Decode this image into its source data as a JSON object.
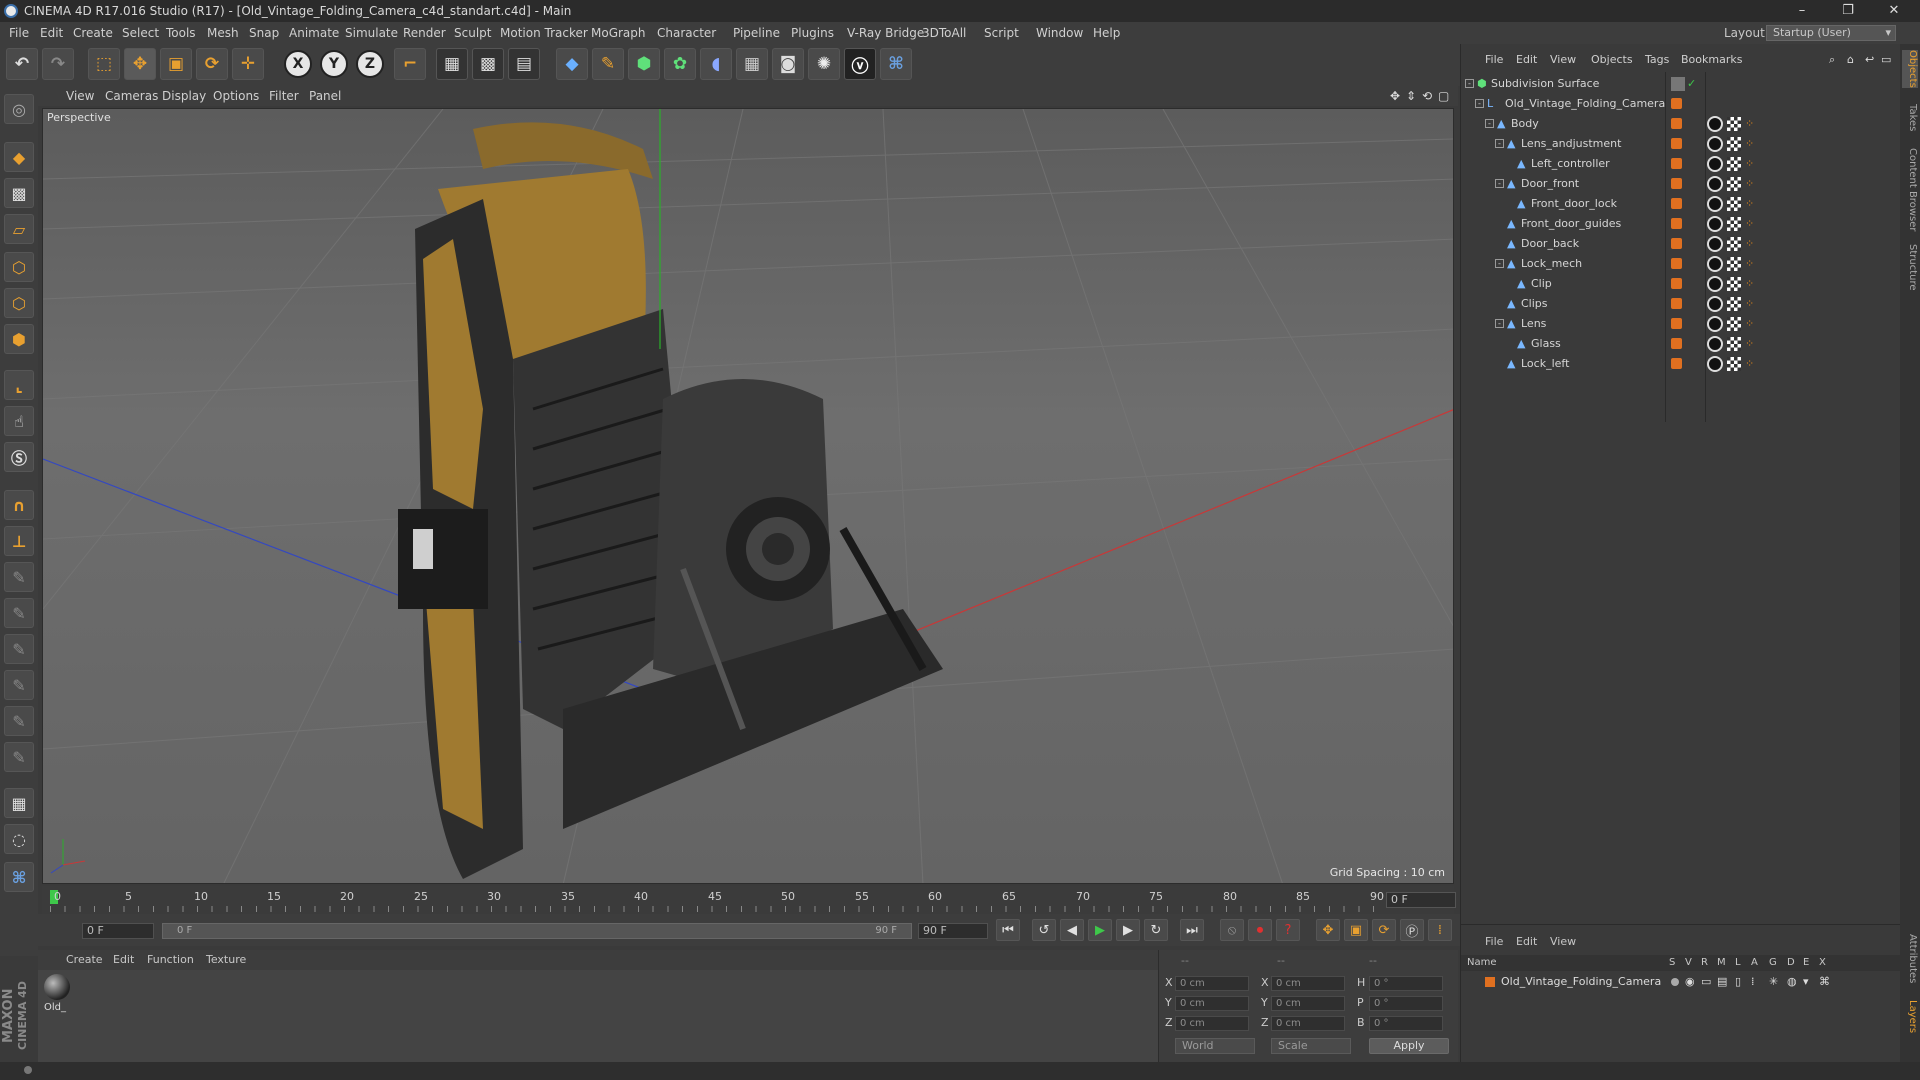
{
  "window": {
    "title": "CINEMA 4D R17.016 Studio (R17) - [Old_Vintage_Folding_Camera_c4d_standart.c4d] - Main",
    "minimize": "–",
    "maximize": "❐",
    "close": "✕"
  },
  "menubar": {
    "items": [
      "File",
      "Edit",
      "Create",
      "Select",
      "Tools",
      "Mesh",
      "Snap",
      "Animate",
      "Simulate",
      "Render",
      "Sculpt",
      "Motion Tracker",
      "MoGraph",
      "Character",
      "Pipeline",
      "Plugins",
      "V-Ray Bridge",
      "3DToAll",
      "Script",
      "Window",
      "Help"
    ],
    "layout_label": "Layout:",
    "layout_value": "Startup (User)"
  },
  "toolbar": {
    "axes": [
      "X",
      "Y",
      "Z"
    ]
  },
  "viewport": {
    "menu": [
      "View",
      "Cameras",
      "Display",
      "Options",
      "Filter",
      "Panel"
    ],
    "label": "Perspective",
    "grid_spacing": "Grid Spacing : 10 cm"
  },
  "timeline": {
    "ticks": [
      "0",
      "5",
      "10",
      "15",
      "20",
      "25",
      "30",
      "35",
      "40",
      "45",
      "50",
      "55",
      "60",
      "65",
      "70",
      "75",
      "80",
      "85",
      "90"
    ],
    "current_frame": "0 F",
    "start_field": "0 F",
    "range_start": "0 F",
    "range_end": "90 F",
    "end_field": "90 F"
  },
  "material_manager": {
    "menu": [
      "Create",
      "Edit",
      "Function",
      "Texture"
    ],
    "materials": [
      {
        "name": "Old_"
      }
    ],
    "brand_line1": "MAXON",
    "brand_line2": "CINEMA 4D"
  },
  "coordinates": {
    "header": [
      "--",
      "--",
      "--"
    ],
    "rows": [
      {
        "l1": "X",
        "v1": "0 cm",
        "l2": "X",
        "v2": "0 cm",
        "l3": "H",
        "v3": "0 °"
      },
      {
        "l1": "Y",
        "v1": "0 cm",
        "l2": "Y",
        "v2": "0 cm",
        "l3": "P",
        "v3": "0 °"
      },
      {
        "l1": "Z",
        "v1": "0 cm",
        "l2": "Z",
        "v2": "0 cm",
        "l3": "B",
        "v3": "0 °"
      }
    ],
    "mode": "World",
    "scale": "Scale",
    "apply": "Apply"
  },
  "object_manager": {
    "menu": [
      "File",
      "Edit",
      "View",
      "Objects",
      "Tags",
      "Bookmarks"
    ],
    "objects": [
      {
        "name": "Subdivision Surface",
        "depth": 0,
        "expand": "-"
      },
      {
        "name": "Old_Vintage_Folding_Camera",
        "depth": 1,
        "expand": "-"
      },
      {
        "name": "Body",
        "depth": 2,
        "expand": "-"
      },
      {
        "name": "Lens_andjustment",
        "depth": 3,
        "expand": "-"
      },
      {
        "name": "Left_controller",
        "depth": 4,
        "expand": ""
      },
      {
        "name": "Door_front",
        "depth": 3,
        "expand": "-"
      },
      {
        "name": "Front_door_lock",
        "depth": 4,
        "expand": ""
      },
      {
        "name": "Front_door_guides",
        "depth": 3,
        "expand": ""
      },
      {
        "name": "Door_back",
        "depth": 3,
        "expand": ""
      },
      {
        "name": "Lock_mech",
        "depth": 3,
        "expand": "-"
      },
      {
        "name": "Clip",
        "depth": 4,
        "expand": ""
      },
      {
        "name": "Clips",
        "depth": 3,
        "expand": ""
      },
      {
        "name": "Lens",
        "depth": 3,
        "expand": "-"
      },
      {
        "name": "Glass",
        "depth": 4,
        "expand": ""
      },
      {
        "name": "Lock_left",
        "depth": 3,
        "expand": ""
      }
    ]
  },
  "layer_manager": {
    "menu": [
      "File",
      "Edit",
      "View"
    ],
    "columns": [
      "Name",
      "S",
      "V",
      "R",
      "M",
      "L",
      "A",
      "G",
      "D",
      "E",
      "X"
    ],
    "rows": [
      {
        "name": "Old_Vintage_Folding_Camera"
      }
    ]
  },
  "side_tabs": [
    "Objects",
    "Takes",
    "Content Browser",
    "Structure",
    "Attributes",
    "Layers"
  ]
}
